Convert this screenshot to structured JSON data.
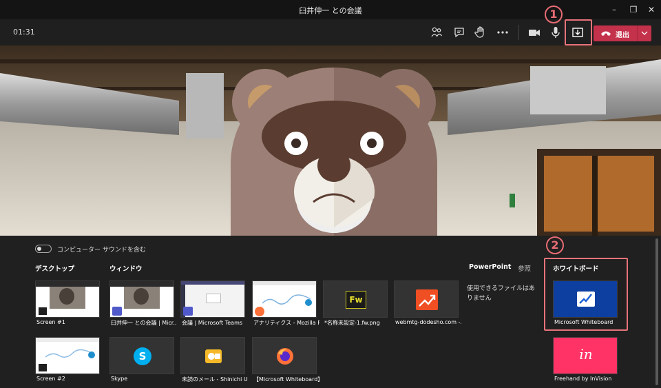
{
  "window": {
    "title": "臼井伸一 との会議"
  },
  "toolbar": {
    "timer": "01:31",
    "leave_label": "退出",
    "badge_1": "1"
  },
  "share": {
    "badge_2": "2",
    "computer_sound": "コンピューター サウンドを含む",
    "desktop_header": "デスクトップ",
    "window_header": "ウィンドウ",
    "powerpoint_header": "PowerPoint",
    "browse_label": "参照",
    "no_files": "使用できるファイルはありません",
    "whiteboard_header": "ホワイトボード",
    "tiles": [
      "Screen #1",
      "臼井伸一 との会議 | Micr...",
      "会議 | Microsoft Teams",
      "アナリティクス - Mozilla Fir...",
      "*名称未設定-1.fw.png",
      "webmtg-dodesho.com -...",
      "Screen #2",
      "Skype",
      "未読のメール - Shinichi Us...",
      "【Microsoft Whiteboard】..."
    ],
    "whiteboard_tiles": [
      "Microsoft Whiteboard",
      "Freehand by InVision"
    ],
    "fw_glyph": "Fw",
    "invision_glyph": "in",
    "skype_glyph": "S"
  },
  "colors": {
    "accent_red": "#c4314b",
    "highlight": "#e8737b",
    "whiteboard_blue": "#0d3fa0",
    "invision_pink": "#ff3366"
  }
}
